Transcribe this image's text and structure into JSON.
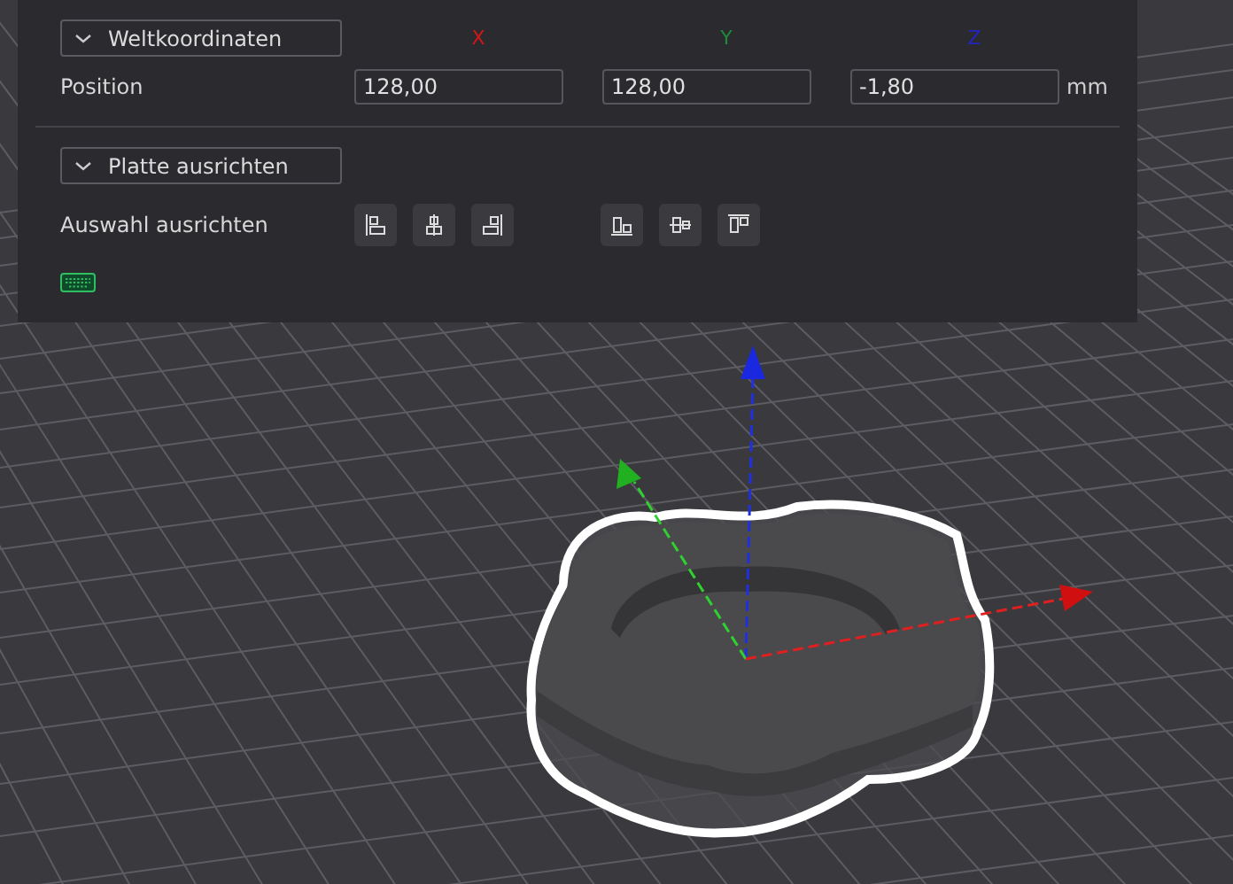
{
  "world_coordinates": {
    "header": "Weltkoordinaten",
    "expanded": true,
    "axes": [
      {
        "label": "X",
        "color": "#d01818"
      },
      {
        "label": "Y",
        "color": "#1f8a3a"
      },
      {
        "label": "Z",
        "color": "#2424c0"
      }
    ],
    "rows": [
      {
        "label": "Position",
        "values": [
          "128,00",
          "128,00",
          "-1,80"
        ],
        "unit": "mm"
      }
    ]
  },
  "plate_align": {
    "header": "Platte ausrichten",
    "expanded": true,
    "label": "Auswahl ausrichten",
    "buttons": [
      {
        "kind": "left"
      },
      {
        "kind": "center-h"
      },
      {
        "kind": "right"
      },
      {
        "kind": "bottom"
      },
      {
        "kind": "center-v"
      },
      {
        "kind": "top"
      }
    ]
  }
}
